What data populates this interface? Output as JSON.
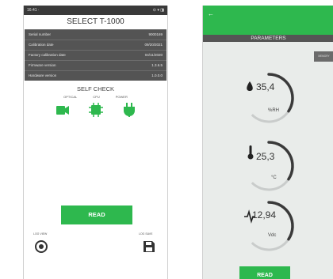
{
  "left": {
    "status": {
      "time": "16:41 ·",
      "icons": "⊙ ▾ ◨"
    },
    "title": "SELECT T-1000",
    "info": [
      {
        "label": "Serial number",
        "value": "9000169"
      },
      {
        "label": "Calibration date",
        "value": "09/20/2021"
      },
      {
        "label": "Factory calibration date",
        "value": "04/11/2020"
      },
      {
        "label": "Firmware version",
        "value": "1.3.6.5"
      },
      {
        "label": "Hardware version",
        "value": "1.0.0.0"
      }
    ],
    "self_check": {
      "title": "SELF CHECK",
      "items": [
        {
          "label": "OPTICAL",
          "icon": "camera-icon"
        },
        {
          "label": "CPU",
          "icon": "chip-icon"
        },
        {
          "label": "POWER",
          "icon": "power-plug-icon"
        }
      ]
    },
    "read_label": "READ",
    "log_view_label": "LOG VIEW",
    "log_save_label": "LOG SAVE"
  },
  "right": {
    "back_icon": "back-arrow-icon",
    "title": "PARAMETERS",
    "memo_label": "MEMORY",
    "gauges": [
      {
        "value": "35,4",
        "unit": "%RH",
        "icon": "drop-icon",
        "level": 0.55
      },
      {
        "value": "25,3",
        "unit": "°C",
        "icon": "thermometer-icon",
        "level": 0.55
      },
      {
        "value": "12,94",
        "unit": "Vdc",
        "icon": "signal-icon",
        "level": 0.55
      }
    ],
    "read_label": "READ"
  },
  "colors": {
    "accent": "#2eb84e",
    "panel": "#545454"
  }
}
